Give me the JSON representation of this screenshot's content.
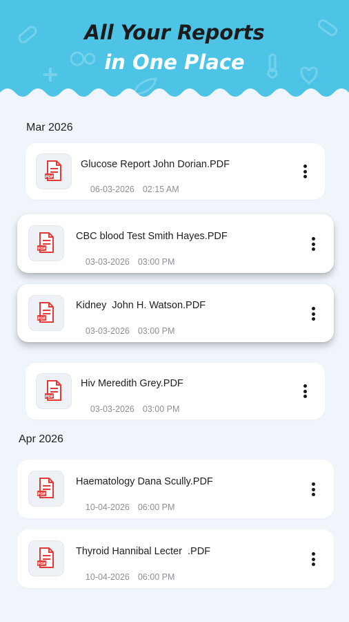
{
  "header": {
    "line1": "All Your Reports",
    "line2": "in One Place"
  },
  "groups": [
    {
      "month": "Mar 2026",
      "reports": [
        {
          "name": "Glucose Report John Dorian.PDF",
          "date": "06-03-2026",
          "time": "02:15 AM",
          "icon": "pdf-file-icon"
        },
        {
          "name": "CBC blood Test Smith Hayes.PDF",
          "date": "03-03-2026",
          "time": "03:00 PM",
          "icon": "pdf-file-icon"
        },
        {
          "name": "Kidney  John H. Watson.PDF",
          "date": "03-03-2026",
          "time": "03:00 PM",
          "icon": "pdf-file-icon"
        },
        {
          "name": "Hiv Meredith Grey.PDF",
          "date": "03-03-2026",
          "time": "03:00 PM",
          "icon": "pdf-file-icon"
        }
      ]
    },
    {
      "month": "Apr 2026",
      "reports": [
        {
          "name": "Haematology Dana Scully.PDF",
          "date": "10-04-2026",
          "time": "06:00 PM",
          "icon": "pdf-file-icon"
        },
        {
          "name": "Thyroid Hannibal Lecter  .PDF",
          "date": "10-04-2026",
          "time": "06:00 PM",
          "icon": "pdf-file-icon"
        }
      ]
    }
  ],
  "colors": {
    "header_bg": "#4dc4e6",
    "page_bg": "#eff5fb",
    "pdf_red": "#e53935",
    "card_bg": "#ffffff"
  }
}
